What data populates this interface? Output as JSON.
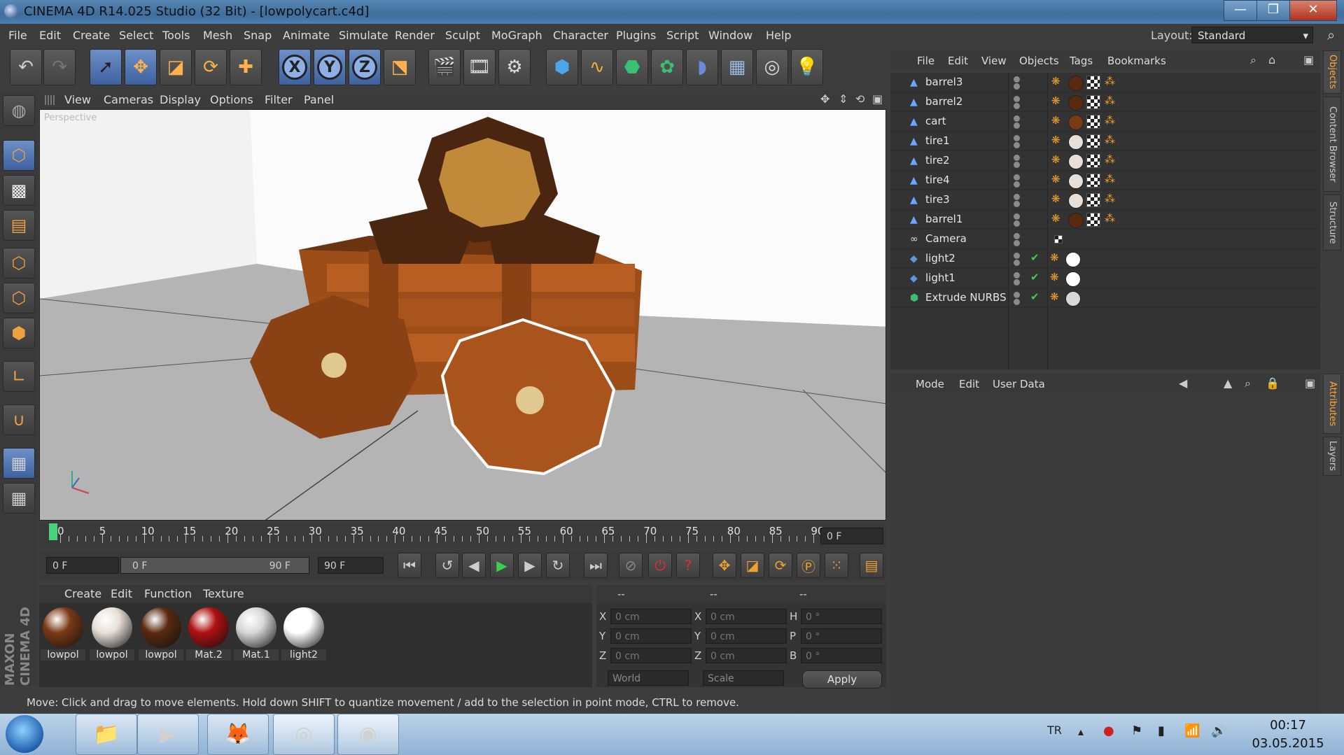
{
  "window": {
    "title": "CINEMA 4D R14.025 Studio (32 Bit) - [lowpolycart.c4d]",
    "minimize": "—",
    "maximize": "❐",
    "close": "✕"
  },
  "menubar": [
    "File",
    "Edit",
    "Create",
    "Select",
    "Tools",
    "Mesh",
    "Snap",
    "Animate",
    "Simulate",
    "Render",
    "Sculpt",
    "MoGraph",
    "Character",
    "Plugins",
    "Script",
    "Window",
    "Help"
  ],
  "layout": {
    "label": "Layout:",
    "value": "Standard"
  },
  "toolbar": {
    "x": "X",
    "y": "Y",
    "z": "Z"
  },
  "viewport": {
    "menu": [
      "View",
      "Cameras",
      "Display",
      "Options",
      "Filter",
      "Panel"
    ],
    "label": "Perspective"
  },
  "timeline": {
    "ticks": [
      "0",
      "5",
      "10",
      "15",
      "20",
      "25",
      "30",
      "35",
      "40",
      "45",
      "50",
      "55",
      "60",
      "65",
      "70",
      "75",
      "80",
      "85",
      "90"
    ],
    "current": "0 F",
    "start": "0 F",
    "range_start": "0 F",
    "range_end": "90 F",
    "end": "90 F"
  },
  "materials": {
    "menu": [
      "Create",
      "Edit",
      "Function",
      "Texture"
    ],
    "items": [
      {
        "label": "lowpol",
        "color": "#7a3a14"
      },
      {
        "label": "lowpol",
        "color": "#e8e0d8"
      },
      {
        "label": "lowpol",
        "color": "#5a2a10"
      },
      {
        "label": "Mat.2",
        "color": "#b01010"
      },
      {
        "label": "Mat.1",
        "color": "#d8d8d8"
      },
      {
        "label": "light2",
        "color": "#ffffff"
      }
    ]
  },
  "coordinates": {
    "headers": [
      "--",
      "--",
      "--"
    ],
    "rows": [
      {
        "a": "X",
        "av": "0 cm",
        "b": "X",
        "bv": "0 cm",
        "c": "H",
        "cv": "0 °"
      },
      {
        "a": "Y",
        "av": "0 cm",
        "b": "Y",
        "bv": "0 cm",
        "c": "P",
        "cv": "0 °"
      },
      {
        "a": "Z",
        "av": "0 cm",
        "b": "Z",
        "bv": "0 cm",
        "c": "B",
        "cv": "0 °"
      }
    ],
    "mode1": "World",
    "mode2": "Scale",
    "apply": "Apply"
  },
  "status": "Move: Click and drag to move elements. Hold down SHIFT to quantize movement / add to the selection in point mode, CTRL to remove.",
  "objects": {
    "menu": [
      "File",
      "Edit",
      "View",
      "Objects",
      "Tags",
      "Bookmarks"
    ],
    "rows": [
      {
        "name": "barrel3",
        "tag": "#5a2a10"
      },
      {
        "name": "barrel2",
        "tag": "#5a2a10"
      },
      {
        "name": "cart",
        "tag": "#7a3a14"
      },
      {
        "name": "tire1",
        "tag": "#e8e0d8"
      },
      {
        "name": "tire2",
        "tag": "#e8e0d8"
      },
      {
        "name": "tire4",
        "tag": "#e8e0d8"
      },
      {
        "name": "tire3",
        "tag": "#e8e0d8"
      },
      {
        "name": "barrel1",
        "tag": "#5a2a10"
      },
      {
        "name": "Camera",
        "tag": ""
      },
      {
        "name": "light2",
        "tag": "#ffffff"
      },
      {
        "name": "light1",
        "tag": "#ffffff"
      },
      {
        "name": "Extrude NURBS",
        "tag": "#d8d8d8"
      }
    ]
  },
  "attributes": {
    "menu": [
      "Mode",
      "Edit",
      "User Data"
    ]
  },
  "sidetabs": [
    "Objects",
    "Content Browser",
    "Structure",
    "Attributes",
    "Layers"
  ],
  "brand": "MAXON CINEMA 4D",
  "taskbar": {
    "lang": "TR",
    "time": "00:17",
    "date": "03.05.2015"
  }
}
